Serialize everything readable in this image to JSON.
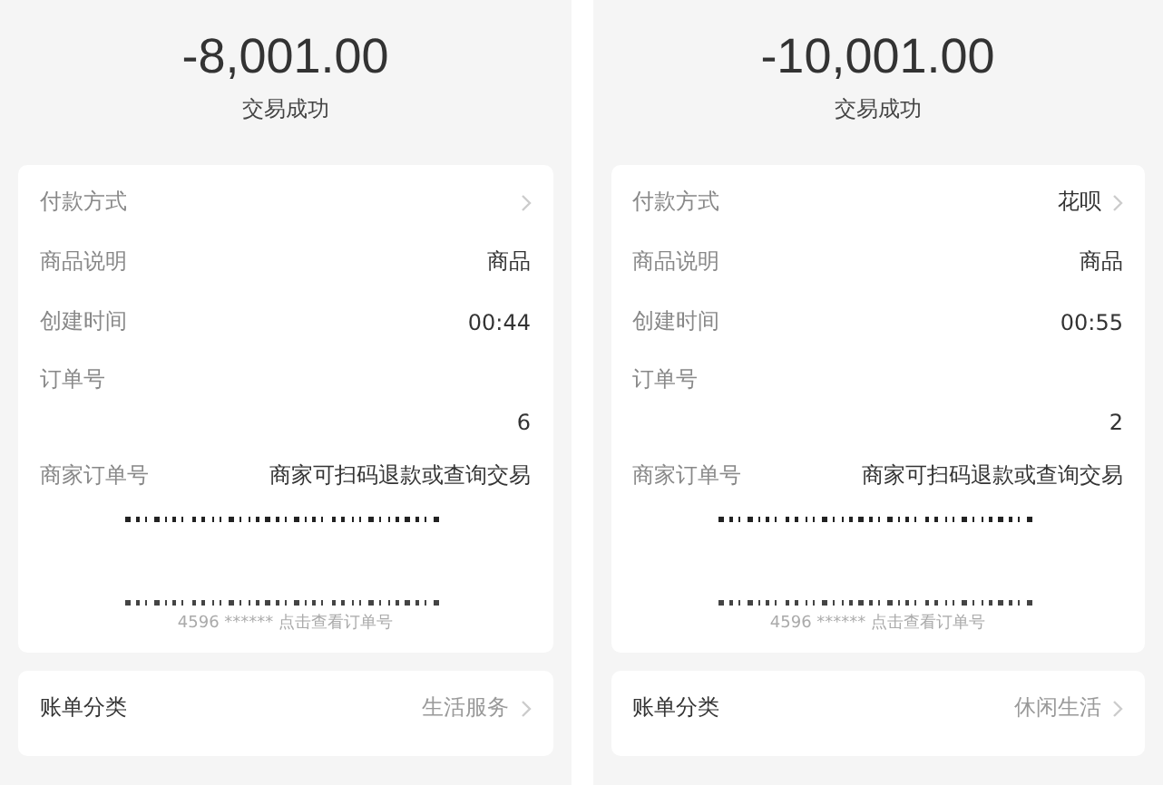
{
  "panels": [
    {
      "amount": "-8,001.00",
      "status": "交易成功",
      "details": [
        {
          "kind": "inline",
          "label": "付款方式",
          "chevron": true
        },
        {
          "kind": "inline",
          "label": "商品说明",
          "value": "商品",
          "chevron": false
        },
        {
          "kind": "inline",
          "label": "创建时间",
          "value": "00:44",
          "chevron": false
        },
        {
          "kind": "stacked",
          "label": "订单号",
          "value": "6",
          "chevron": false
        },
        {
          "kind": "inline",
          "label": "商家订单号",
          "value": "商家可扫码退款或查询交易",
          "chevron": false
        }
      ],
      "barcode_caption": "4596 ****** 点击查看订单号",
      "category": {
        "label": "账单分类",
        "value": "生活服务",
        "chevron": true
      }
    },
    {
      "amount": "-10,001.00",
      "status": "交易成功",
      "details": [
        {
          "kind": "inline",
          "label": "付款方式",
          "value": "花呗",
          "chevron": true
        },
        {
          "kind": "inline",
          "label": "商品说明",
          "value": "商品",
          "chevron": false
        },
        {
          "kind": "inline",
          "label": "创建时间",
          "value": "00:55",
          "chevron": false
        },
        {
          "kind": "stacked",
          "label": "订单号",
          "value": "2",
          "chevron": false
        },
        {
          "kind": "inline",
          "label": "商家订单号",
          "value": "商家可扫码退款或查询交易",
          "chevron": false
        }
      ],
      "barcode_caption": "4596 ****** 点击查看订单号",
      "category": {
        "label": "账单分类",
        "value": "休闲生活",
        "chevron": true
      }
    }
  ]
}
